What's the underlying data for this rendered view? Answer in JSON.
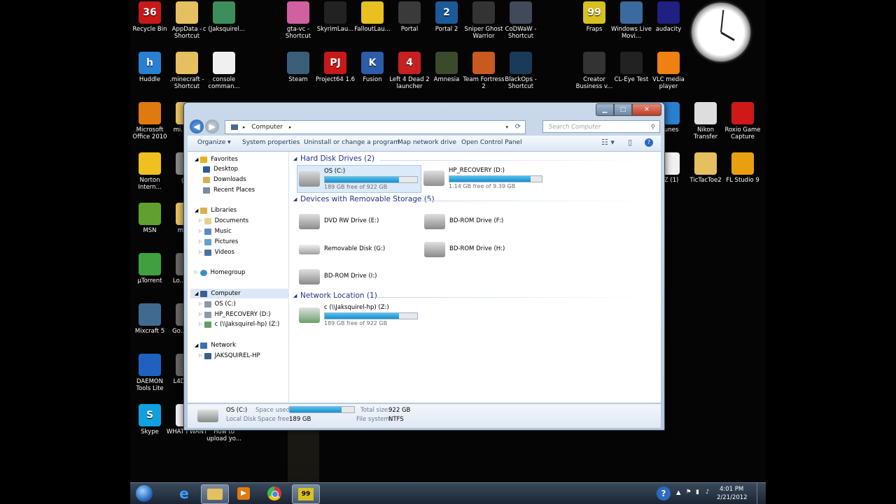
{
  "desktop_icons": [
    {
      "label": "Recycle Bin",
      "glyph": "36",
      "color": "#c81818"
    },
    {
      "label": "AppData - Shortcut",
      "glyph": "",
      "color": "#e6c060"
    },
    {
      "label": "c (Jaksquirel...",
      "glyph": "",
      "color": "#3c8f5a"
    },
    {
      "label": "gta-vc - Shortcut",
      "glyph": "",
      "color": "#d060a0"
    },
    {
      "label": "SkyrimLau...",
      "glyph": "",
      "color": "#222222"
    },
    {
      "label": "FalloutLau...",
      "glyph": "",
      "color": "#e8c020"
    },
    {
      "label": "Portal",
      "glyph": "",
      "color": "#3a3a3a"
    },
    {
      "label": "Portal 2",
      "glyph": "2",
      "color": "#1a5a9a"
    },
    {
      "label": "Sniper Ghost Warrior",
      "glyph": "",
      "color": "#333333"
    },
    {
      "label": "CoDWaW - Shortcut",
      "glyph": "",
      "color": "#404a5a"
    },
    {
      "label": "Fraps",
      "glyph": "99",
      "color": "#d8c020"
    },
    {
      "label": "Windows Live Movi...",
      "glyph": "",
      "color": "#3a6aa0"
    },
    {
      "label": "audacity",
      "glyph": "",
      "color": "#202080"
    },
    {
      "label": "Huddle",
      "glyph": "h",
      "color": "#2a7fd0"
    },
    {
      "label": ".minecraft - Shortcut",
      "glyph": "",
      "color": "#e6c060"
    },
    {
      "label": "console comman...",
      "glyph": "",
      "color": "#f0f0f0"
    },
    {
      "label": "Steam",
      "glyph": "",
      "color": "#3b5f78"
    },
    {
      "label": "Project64 1.6",
      "glyph": "PJ",
      "color": "#c81818"
    },
    {
      "label": "Fusion",
      "glyph": "K",
      "color": "#2b5da8"
    },
    {
      "label": "Left 4 Dead 2 launcher",
      "glyph": "4",
      "color": "#c82020"
    },
    {
      "label": "Amnesia",
      "glyph": "",
      "color": "#3a4a2a"
    },
    {
      "label": "Team Fortress 2",
      "glyph": "",
      "color": "#c85a20"
    },
    {
      "label": "BlackOps - Shortcut",
      "glyph": "",
      "color": "#1a3a5a"
    },
    {
      "label": "Creator Business v...",
      "glyph": "",
      "color": "#333333"
    },
    {
      "label": "CL-Eye Test",
      "glyph": "",
      "color": "#222222"
    },
    {
      "label": "VLC media player",
      "glyph": "",
      "color": "#f08010"
    },
    {
      "label": "Microsoft Office 2010",
      "glyph": "",
      "color": "#e07a10"
    },
    {
      "label": "mi... sc...",
      "glyph": "",
      "color": "#e6c060"
    },
    {
      "label": "Norton Intern...",
      "glyph": "",
      "color": "#f0c020"
    },
    {
      "label": "gi...",
      "glyph": "",
      "color": "#888888"
    },
    {
      "label": "MSN",
      "glyph": "",
      "color": "#60a030"
    },
    {
      "label": "mcp...",
      "glyph": "",
      "color": "#e6c060"
    },
    {
      "label": "µTorrent",
      "glyph": "",
      "color": "#40a040"
    },
    {
      "label": "Lo... Ha...",
      "glyph": "",
      "color": "#666666"
    },
    {
      "label": "Mixcraft 5",
      "glyph": "",
      "color": "#406a90"
    },
    {
      "label": "Go... Ch...",
      "glyph": "",
      "color": "#666666"
    },
    {
      "label": "DAEMON Tools Lite",
      "glyph": "",
      "color": "#2060c0"
    },
    {
      "label": "L4D2 C...",
      "glyph": "",
      "color": "#666666"
    },
    {
      "label": "Skype",
      "glyph": "S",
      "color": "#10a0e0"
    },
    {
      "label": "WHAT I WANT",
      "glyph": "",
      "color": "#f0f0f0"
    },
    {
      "label": "How to upload yo...",
      "glyph": "",
      "color": "#f0f0f0"
    },
    {
      "label": "...unes",
      "glyph": "",
      "color": "#2a7fd0"
    },
    {
      "label": "Nikon Transfer",
      "glyph": "",
      "color": "#dddddd"
    },
    {
      "label": "Roxio Game Capture",
      "glyph": "",
      "color": "#d01818"
    },
    {
      "label": "...Z (1)",
      "glyph": "",
      "color": "#f0f0f0"
    },
    {
      "label": "TicTacToe2",
      "glyph": "",
      "color": "#e6c060"
    },
    {
      "label": "FL Studio 9",
      "glyph": "",
      "color": "#e8a010"
    }
  ],
  "window": {
    "breadcrumb_root": "Computer",
    "search_placeholder": "Search Computer",
    "toolbar": {
      "organize": "Organize ▾",
      "system_properties": "System properties",
      "uninstall": "Uninstall or change a program",
      "map_drive": "Map network drive",
      "control_panel": "Open Control Panel"
    },
    "nav": {
      "favorites": "Favorites",
      "desktop": "Desktop",
      "downloads": "Downloads",
      "recent": "Recent Places",
      "libraries": "Libraries",
      "documents": "Documents",
      "music": "Music",
      "pictures": "Pictures",
      "videos": "Videos",
      "homegroup": "Homegroup",
      "computer": "Computer",
      "os_c": "OS (C:)",
      "hp_recovery": "HP_RECOVERY (D:)",
      "net_z": "c (\\\\Jaksquirel-hp) (Z:)",
      "network": "Network",
      "jaksquirel_hp": "JAKSQUIREL-HP"
    },
    "groups": {
      "hdd": "Hard Disk Drives (2)",
      "removable": "Devices with Removable Storage (5)",
      "network": "Network Location (1)"
    },
    "drives": {
      "c": {
        "name": "OS (C:)",
        "free": "189 GB free of 922 GB",
        "used_fraction": 0.8
      },
      "d": {
        "name": "HP_RECOVERY (D:)",
        "free": "1.14 GB free of 9.39 GB",
        "used_fraction": 0.88
      },
      "e": {
        "name": "DVD RW Drive (E:)"
      },
      "f": {
        "name": "BD-ROM Drive (F:)"
      },
      "g": {
        "name": "Removable Disk (G:)"
      },
      "h": {
        "name": "BD-ROM Drive (H:)"
      },
      "i": {
        "name": "BD-ROM Drive (I:)"
      },
      "z": {
        "name": "c (\\\\Jaksquirel-hp) (Z:)",
        "free": "189 GB free of 922 GB",
        "used_fraction": 0.8
      }
    },
    "details": {
      "name": "OS (C:)",
      "type": "Local Disk",
      "space_used_label": "Space used:",
      "space_free_label": "Space free:",
      "space_free": "189 GB",
      "total_size_label": "Total size:",
      "total_size": "922 GB",
      "filesystem_label": "File system:",
      "filesystem": "NTFS",
      "used_fraction": 0.8
    }
  },
  "taskbar": {
    "time": "4:01 PM",
    "date": "2/21/2012",
    "fraps_badge": "99"
  },
  "colors": {
    "accent": "#1a8fc7",
    "group_header": "#1e3287",
    "taskbar": "#1a2533"
  }
}
